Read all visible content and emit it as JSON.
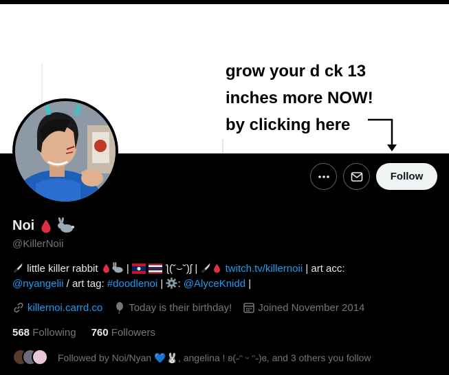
{
  "banner": {
    "lines": [
      "grow your d ck 13",
      "inches more NOW!",
      "by clicking here"
    ]
  },
  "actions": {
    "follow_label": "Follow"
  },
  "profile": {
    "name": "Noi",
    "handle": "@KillerNoii",
    "bio": {
      "part1": "little killer rabbit",
      "part2": " | ",
      "kaomoji": "ƪ(˘⌣˘)ʃ",
      "part3": " | ",
      "link": "twitch.tv/killernoii",
      "part4": " | art acc: ",
      "mention1": "@nyangelii",
      "part5": " / art tag: ",
      "hashtag": "#doodlenoi",
      "part6": " | ",
      "part7": ": ",
      "mention2": "@AlyceKnidd",
      "part8": " |"
    }
  },
  "meta": {
    "website": "killernoi.carrd.co",
    "birthday": "Today is their birthday!",
    "joined": "Joined November 2014"
  },
  "stats": {
    "following_count": "568",
    "following_label": "Following",
    "followers_count": "760",
    "followers_label": "Followers"
  },
  "followed_by": {
    "text": "Followed by Noi/Nyan 💙🐰, angelina ! ʚ(˶ᵔ ᵕ ᵔ˶)ɞ, and 3 others you follow"
  },
  "colors": {
    "accent": "#1d9bf0",
    "muted": "#71767b",
    "text": "#e7e9ea",
    "background": "#000000"
  },
  "icons": [
    "more-icon",
    "mail-icon",
    "link-icon",
    "balloon-icon",
    "calendar-icon",
    "knife-icon",
    "blood-drop-icon",
    "rabbit-icon",
    "gear-icon"
  ]
}
